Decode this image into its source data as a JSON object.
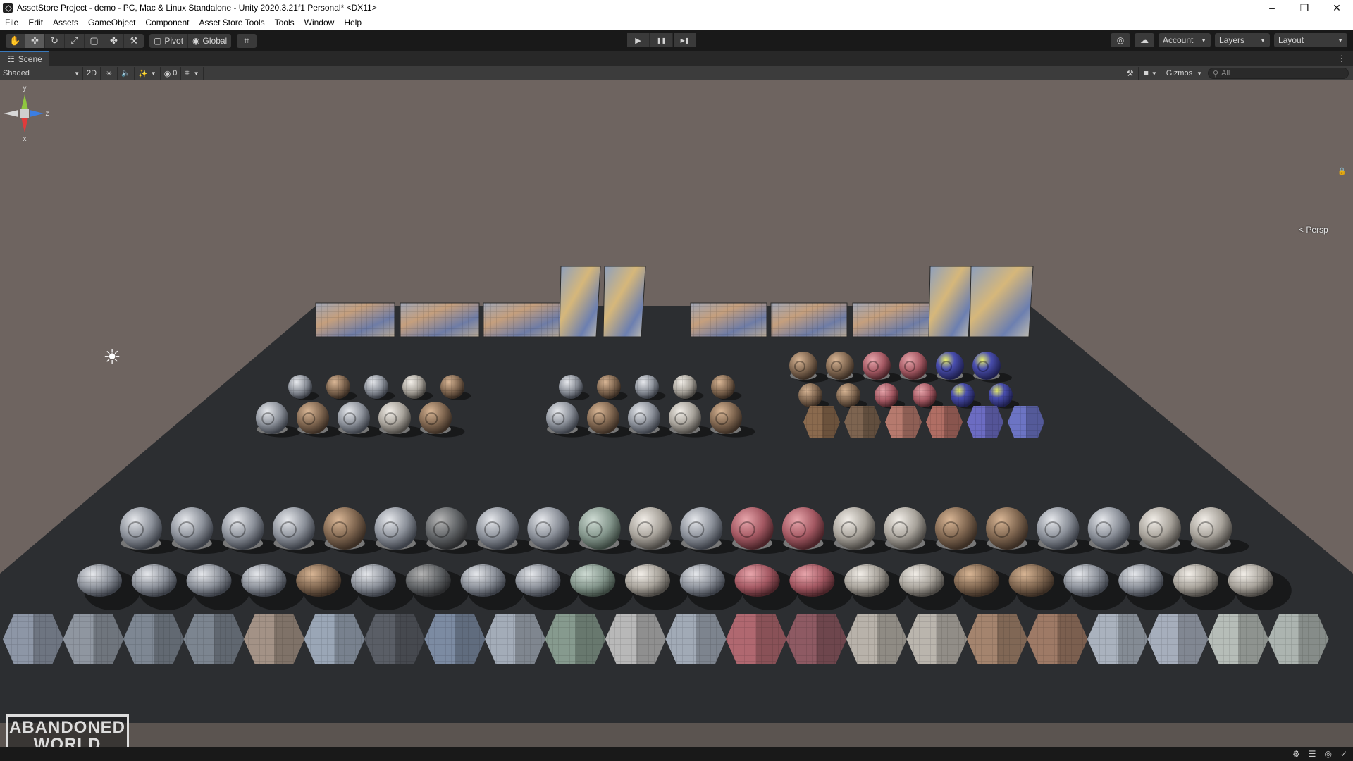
{
  "window": {
    "title": "AssetStore Project - demo - PC, Mac & Linux Standalone - Unity 2020.3.21f1 Personal* <DX11>",
    "controls": {
      "minimize": "–",
      "restore": "❒",
      "close": "✕"
    }
  },
  "menu": [
    "File",
    "Edit",
    "Assets",
    "GameObject",
    "Component",
    "Asset Store Tools",
    "Tools",
    "Window",
    "Help"
  ],
  "toolbar": {
    "tools": [
      {
        "name": "hand-tool",
        "glyph": "✋"
      },
      {
        "name": "move-tool",
        "glyph": "✜"
      },
      {
        "name": "rotate-tool",
        "glyph": "↻"
      },
      {
        "name": "scale-tool",
        "glyph": "⤢"
      },
      {
        "name": "rect-tool",
        "glyph": "▢"
      },
      {
        "name": "transform-tool",
        "glyph": "✤"
      },
      {
        "name": "custom-tool",
        "glyph": "⚒"
      }
    ],
    "pivot_label": "Pivot",
    "global_label": "Global",
    "snap_glyph": "⌗",
    "play_glyph": "▶",
    "pause_glyph": "❚❚",
    "step_glyph": "▶❚",
    "collab_glyph": "◎",
    "cloud_glyph": "☁",
    "account_label": "Account",
    "layers_label": "Layers",
    "layout_label": "Layout"
  },
  "scene_tab": {
    "label": "Scene",
    "icon": "☷",
    "menu_glyph": "⋮"
  },
  "scene_toolbar": {
    "shading_mode": "Shaded",
    "mode_2d": "2D",
    "lighting_glyph": "☀",
    "audio_glyph": "🔈",
    "effects_glyph": "✨",
    "hidden_count": "0",
    "grid_glyph": "⌗",
    "tools_glyph": "⚒",
    "camera_glyph": "■",
    "gizmos_label": "Gizmos",
    "search_placeholder": "All"
  },
  "gizmo": {
    "y_label": "y",
    "x_label": "x",
    "z_label": "z",
    "projection": "< Persp",
    "lock_glyph": "🔒"
  },
  "logo": {
    "line1": "ABANDONED",
    "line2": "WORLD"
  },
  "status_icons": [
    "⚙",
    "☰",
    "◎",
    "✓"
  ],
  "colors": {
    "accent_tab": "#3a79bb",
    "viewport_bg": "#6e6460",
    "ground": "#2c2e31"
  }
}
